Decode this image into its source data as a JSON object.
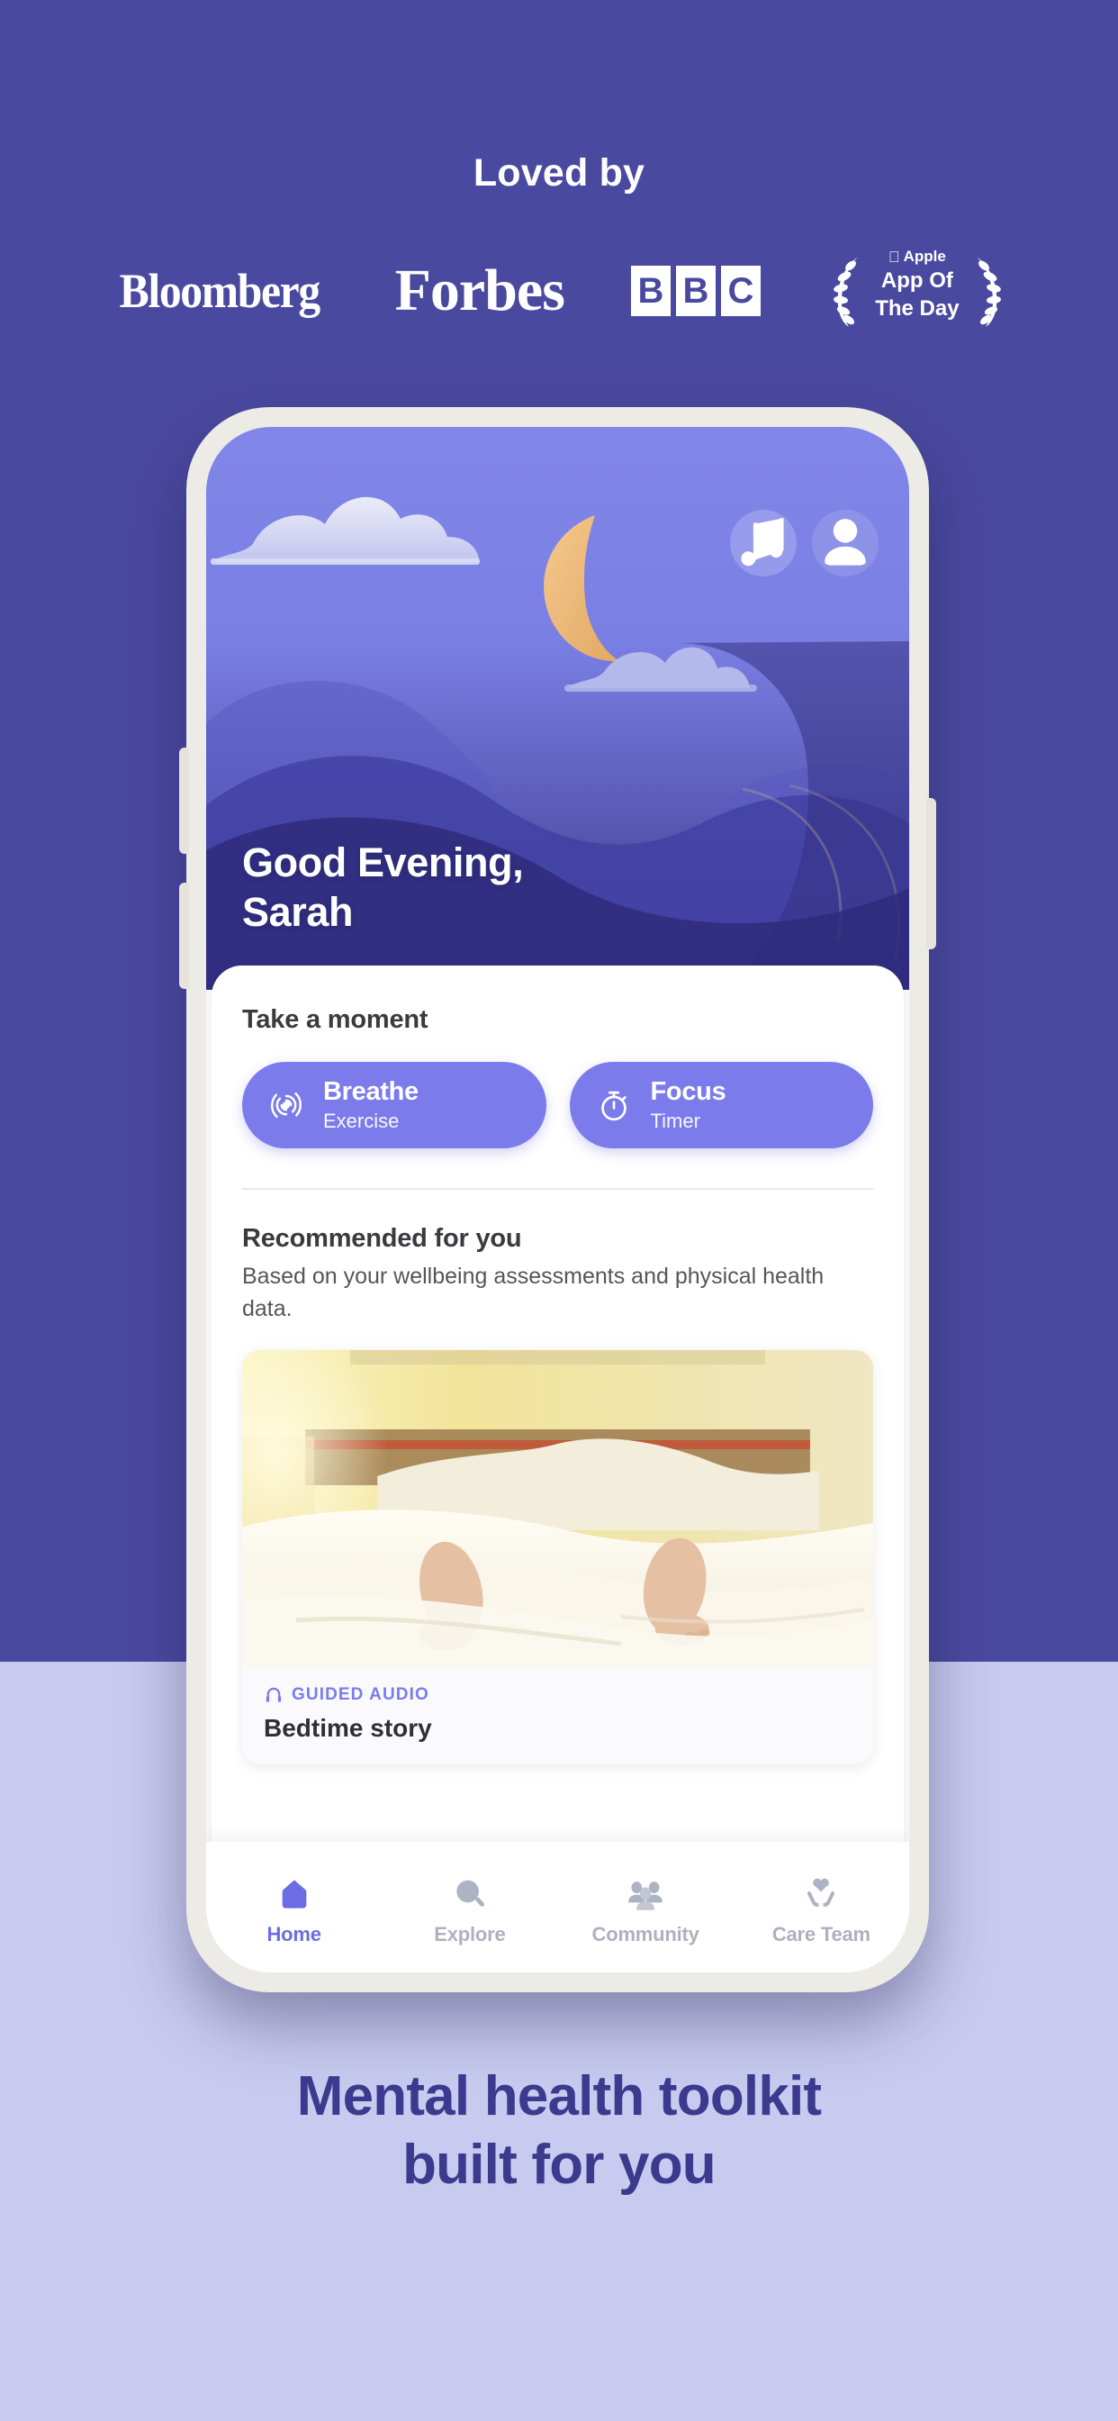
{
  "background": {
    "top_color": "#4A49A0",
    "bottom_color": "#C8CBEF"
  },
  "press": {
    "heading": "Loved by",
    "logos": [
      {
        "name": "Bloomberg",
        "label": "Bloomberg"
      },
      {
        "name": "Forbes",
        "label": "Forbes"
      },
      {
        "name": "BBC",
        "letters": [
          "B",
          "B",
          "C"
        ]
      },
      {
        "name": "Apple App Of The Day",
        "brand": "Apple",
        "line2": "App Of",
        "line3": "The Day"
      }
    ]
  },
  "phone": {
    "hero": {
      "greeting_line1": "Good Evening,",
      "greeting_line2": "Sarah",
      "music_button": "music-note-icon",
      "profile_button": "profile-icon"
    },
    "card": {
      "take_a_moment": {
        "title": "Take a moment",
        "actions": [
          {
            "icon": "breathe-rings-icon",
            "title": "Breathe",
            "subtitle": "Exercise"
          },
          {
            "icon": "stopwatch-icon",
            "title": "Focus",
            "subtitle": "Timer"
          }
        ]
      },
      "recommended": {
        "title": "Recommended for you",
        "subtitle": "Based on your wellbeing assessments and physical health data.",
        "item": {
          "tag_icon": "headphones-icon",
          "tag": "GUIDED AUDIO",
          "title": "Bedtime story"
        }
      }
    },
    "nav": {
      "items": [
        {
          "icon": "home-icon",
          "label": "Home",
          "active": true
        },
        {
          "icon": "search-icon",
          "label": "Explore",
          "active": false
        },
        {
          "icon": "community-icon",
          "label": "Community",
          "active": false
        },
        {
          "icon": "care-team-icon",
          "label": "Care Team",
          "active": false
        }
      ]
    }
  },
  "tagline": {
    "line1": "Mental health toolkit",
    "line2": "built for you"
  },
  "colors": {
    "accent": "#7B7BEB",
    "accent_text": "#6C6CE5",
    "tagline": "#3B3A8E",
    "phone_frame": "#EDEBE6"
  }
}
